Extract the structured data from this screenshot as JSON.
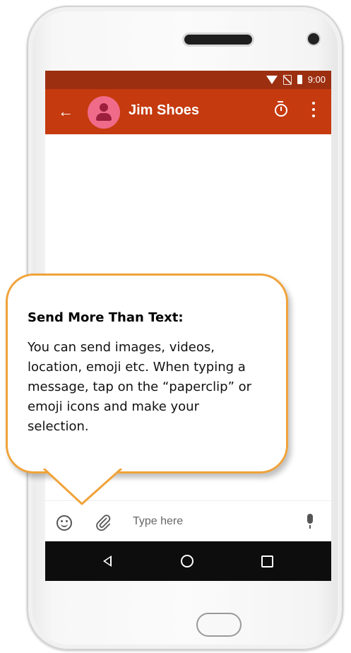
{
  "status_bar": {
    "time": "9:00"
  },
  "app_bar": {
    "contact_name": "Jim Shoes"
  },
  "input_bar": {
    "placeholder": "Type here"
  },
  "callout": {
    "title": "Send More Than Text:",
    "body": "You can send images, videos, location, emoji etc. When typing a message, tap on the “paperclip” or emoji icons and make your selection."
  },
  "colors": {
    "status_bar": "#9c2f10",
    "app_bar": "#c53a0e",
    "avatar": "#f06b8a",
    "callout_border": "#f0a33a",
    "nav_bar": "#0d0d0d"
  },
  "icons": [
    "back-arrow-icon",
    "contact-avatar-icon",
    "timer-icon",
    "more-vert-icon",
    "emoji-icon",
    "paperclip-icon",
    "microphone-icon",
    "nav-back-icon",
    "nav-home-icon",
    "nav-recent-icon",
    "wifi-icon",
    "no-sim-icon",
    "battery-icon"
  ]
}
